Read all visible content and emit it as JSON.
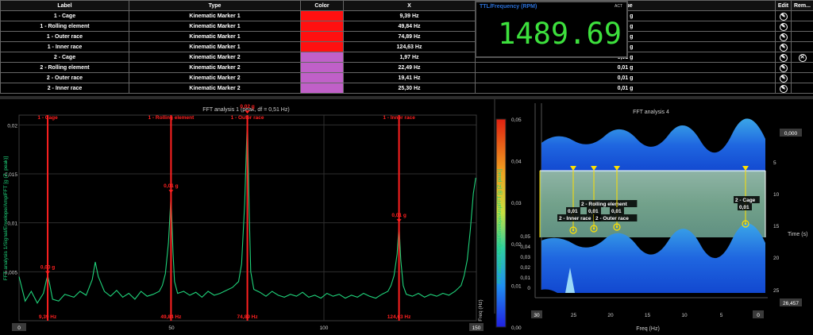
{
  "table": {
    "headers": [
      "Label",
      "Type",
      "Color",
      "X",
      "Value",
      "Edit",
      "Rem..."
    ],
    "rows": [
      {
        "label": "1 - Cage",
        "type": "Kinematic Marker 1",
        "color": "#ff1010",
        "x": "9,39 Hz",
        "value": "0,00 g",
        "removable": false
      },
      {
        "label": "1 - Rolling element",
        "type": "Kinematic Marker 1",
        "color": "#ff1010",
        "x": "49,84 Hz",
        "value": "0,01 g",
        "removable": false
      },
      {
        "label": "1 - Outer race",
        "type": "Kinematic Marker 1",
        "color": "#ff1010",
        "x": "74,89 Hz",
        "value": "0,02 g",
        "removable": false
      },
      {
        "label": "1 - Inner race",
        "type": "Kinematic Marker 1",
        "color": "#ff1010",
        "x": "124,63 Hz",
        "value": "0,01 g",
        "removable": false
      },
      {
        "label": "2 - Cage",
        "type": "Kinematic Marker 2",
        "color": "#c060c8",
        "x": "1,97 Hz",
        "value": "0,01 g",
        "removable": true
      },
      {
        "label": "2 - Rolling element",
        "type": "Kinematic Marker 2",
        "color": "#c060c8",
        "x": "22,49 Hz",
        "value": "0,01 g",
        "removable": false
      },
      {
        "label": "2 - Outer race",
        "type": "Kinematic Marker 2",
        "color": "#c060c8",
        "x": "19,41 Hz",
        "value": "0,01 g",
        "removable": false
      },
      {
        "label": "2 - Inner race",
        "type": "Kinematic Marker 2",
        "color": "#c060c8",
        "x": "25,30 Hz",
        "value": "0,01 g",
        "removable": false
      }
    ]
  },
  "ttl": {
    "title": "TTL/Frequency (RPM)",
    "badge": "ACT",
    "value": "1489.69"
  },
  "icons": {
    "edit": "edit-pencil-icon",
    "remove": "remove-circle-x-icon"
  },
  "colors": {
    "signal": "#1fd27a",
    "marker": "#ff2020",
    "grid": "#2e2e2e",
    "axis_text": "#cfcfcf",
    "highlight": "#ffe000"
  },
  "chart_data": [
    {
      "type": "line",
      "title": "FFT analysis 1 (peak, df = 0,51 Hz)",
      "ylabel": "FFT analysis 1/Signal/Envelope/AmplFFT [g (Z, peak)]",
      "xlabel": "Freq (Hz)",
      "xlim": [
        0,
        150
      ],
      "ylim": [
        0,
        0.021
      ],
      "x_ticks": [
        "0",
        "50",
        "100",
        "150"
      ],
      "y_ticks": [
        "0,02",
        "0,015",
        "0,01",
        "0,005"
      ],
      "grid": true,
      "cursor_labels": {
        "x_left": "0",
        "x_right": "150"
      },
      "markers": [
        {
          "name": "1 - Cage",
          "x": 9.39,
          "x_label": "9,39 Hz",
          "value_label": "0,00 g",
          "value": 0.0045
        },
        {
          "name": "1 - Rolling element",
          "x": 49.84,
          "x_label": "49,84 Hz",
          "value_label": "0,01 g",
          "value": 0.0128
        },
        {
          "name": "1 - Outer race",
          "x": 74.89,
          "x_label": "74,89 Hz",
          "value_label": "0,02 g",
          "value": 0.0209
        },
        {
          "name": "1 - Inner race",
          "x": 124.63,
          "x_label": "124,63 Hz",
          "value_label": "0,01 g",
          "value": 0.0098
        }
      ],
      "series": [
        {
          "x": [
            0,
            2,
            4,
            6,
            8,
            9,
            9.39,
            10,
            11,
            13,
            15,
            18,
            20,
            22,
            24,
            25,
            26,
            28,
            30,
            32,
            34,
            36,
            38,
            40,
            42,
            44,
            46,
            47,
            48,
            49,
            49.84,
            50.5,
            51,
            52,
            54,
            56,
            58,
            60,
            62,
            64,
            66,
            68,
            70,
            72,
            73,
            74,
            74.89,
            75.5,
            76,
            77,
            79,
            81,
            83,
            85,
            87,
            89,
            91,
            93,
            95,
            97,
            99,
            101,
            103,
            105,
            107,
            109,
            111,
            113,
            115,
            117,
            119,
            121,
            122,
            123,
            124,
            124.63,
            125.2,
            126,
            127,
            129,
            131,
            133,
            135,
            137,
            139,
            141,
            143,
            145,
            146,
            147,
            148,
            149,
            149.8
          ],
          "y": [
            0.0045,
            0.002,
            0.003,
            0.0018,
            0.0028,
            0.0042,
            0.0046,
            0.0038,
            0.0022,
            0.002,
            0.0027,
            0.0024,
            0.003,
            0.0026,
            0.0042,
            0.006,
            0.0045,
            0.003,
            0.0025,
            0.0031,
            0.0024,
            0.0028,
            0.0022,
            0.003,
            0.0025,
            0.0027,
            0.003,
            0.0036,
            0.0048,
            0.008,
            0.0128,
            0.007,
            0.004,
            0.0028,
            0.003,
            0.0026,
            0.0029,
            0.0024,
            0.003,
            0.0026,
            0.0028,
            0.0031,
            0.0034,
            0.004,
            0.0058,
            0.012,
            0.0209,
            0.011,
            0.005,
            0.0032,
            0.0029,
            0.0025,
            0.003,
            0.0026,
            0.0024,
            0.0027,
            0.0025,
            0.0029,
            0.0024,
            0.0026,
            0.0023,
            0.0028,
            0.0025,
            0.0027,
            0.0023,
            0.0026,
            0.0024,
            0.0028,
            0.0025,
            0.0023,
            0.0027,
            0.003,
            0.0036,
            0.0046,
            0.0068,
            0.0098,
            0.0062,
            0.0036,
            0.0027,
            0.0025,
            0.0028,
            0.0024,
            0.0027,
            0.0025,
            0.0028,
            0.0026,
            0.003,
            0.0036,
            0.0046,
            0.0062,
            0.0092,
            0.013,
            0.0146
          ]
        }
      ]
    },
    {
      "type": "heatmap",
      "title": "FFT analysis 4",
      "zlabel": "FFT analysis 4/Signal/Envelope/AmplFFT [g (Z, peak)]",
      "xlabel": "Freq (Hz)",
      "ylabel": "Time (s)",
      "xlim": [
        30,
        0
      ],
      "x_ticks": [
        "30",
        "25",
        "20",
        "15",
        "10",
        "5",
        "0"
      ],
      "time_ticks": [
        "0,000",
        "5",
        "10",
        "15",
        "20",
        "25",
        "26,457"
      ],
      "colorbar_ticks": [
        "0,05",
        "0,04",
        "0,03",
        "0,02",
        "0,01",
        "0,00"
      ],
      "wall_ticks": [
        "0,05",
        "0,04",
        "0,03",
        "0,02",
        "0,01",
        "0"
      ],
      "markers": [
        {
          "name": "2 - Inner race",
          "x": 25.3,
          "value_label": "0,01"
        },
        {
          "name": "2 - Rolling element",
          "x": 22.49,
          "value_label": "0,01"
        },
        {
          "name": "2 - Outer race",
          "x": 19.41,
          "value_label": "0,01"
        },
        {
          "name": "2 - Cage",
          "x": 1.97,
          "value_label": "0,01"
        }
      ]
    }
  ]
}
